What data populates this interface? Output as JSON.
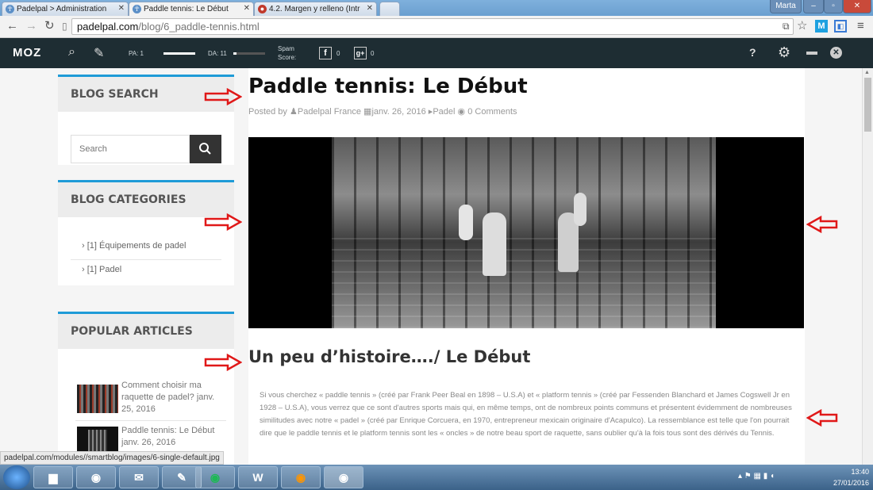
{
  "browser": {
    "tabs": [
      {
        "label": "Padelpal > Administration"
      },
      {
        "label": "Paddle tennis: Le Début"
      },
      {
        "label": "4.2. Margen y relleno (Intr"
      }
    ],
    "user_label": "Marta",
    "url_host": "padelpal.com",
    "url_path": "/blog/6_paddle-tennis.html"
  },
  "mozbar": {
    "logo": "MOZ",
    "pa_label": "PA: 1",
    "da_label": "DA: 11",
    "spam_label": "Spam",
    "score_label": "Score:",
    "facebook_count": "0",
    "gplus_count": "0",
    "help": "?"
  },
  "sidebar": {
    "search_title": "BLOG SEARCH",
    "search_placeholder": "Search",
    "categories_title": "BLOG CATEGORIES",
    "categories": [
      {
        "label": "[1] Équipements de padel"
      },
      {
        "label": "[1] Padel"
      }
    ],
    "popular_title": "POPULAR ARTICLES",
    "articles": [
      {
        "title": "Comment choisir ma raquette de padel?",
        "date": "janv. 25, 2016"
      },
      {
        "title": "Paddle tennis: Le Début",
        "date": "janv. 26, 2016"
      }
    ]
  },
  "post": {
    "title": "Paddle tennis: Le Début",
    "posted_by": "Posted by",
    "author": "Padelpal France",
    "date": "janv. 26, 2016",
    "tag": "Padel",
    "comments": "0 Comments",
    "subtitle": "Un peu d’histoire…./ Le Début",
    "body": "Si vous cherchez « paddle tennis » (créé par Frank Peer Beal en 1898 – U.S.A) et « platform tennis » (créé par Fessenden Blanchard et James Cogswell Jr en 1928 – U.S.A), vous verrez que ce sont d'autres sports mais qui, en même temps, ont de nombreux points communs et présentent évidemment de nombreuses similitudes avec notre « padel » (créé par Enrique Corcuera, en 1970, entrepreneur mexicain originaire d'Acapulco). La ressemblance est telle que l'on pourrait dire que le paddle tennis et le platform tennis sont les « oncles » de notre beau sport de raquette, sans oublier qu'à la fois tous sont des dérivés du Tennis."
  },
  "status_url": "padelpal.com/modules//smartblog/images/6-single-default.jpg",
  "taskbar": {
    "time": "13:40",
    "date": "27/01/2016"
  },
  "colors": {
    "accent": "#1e9bd7",
    "mozbar": "#1e2d33",
    "annotation_arrow": "#e01818"
  }
}
